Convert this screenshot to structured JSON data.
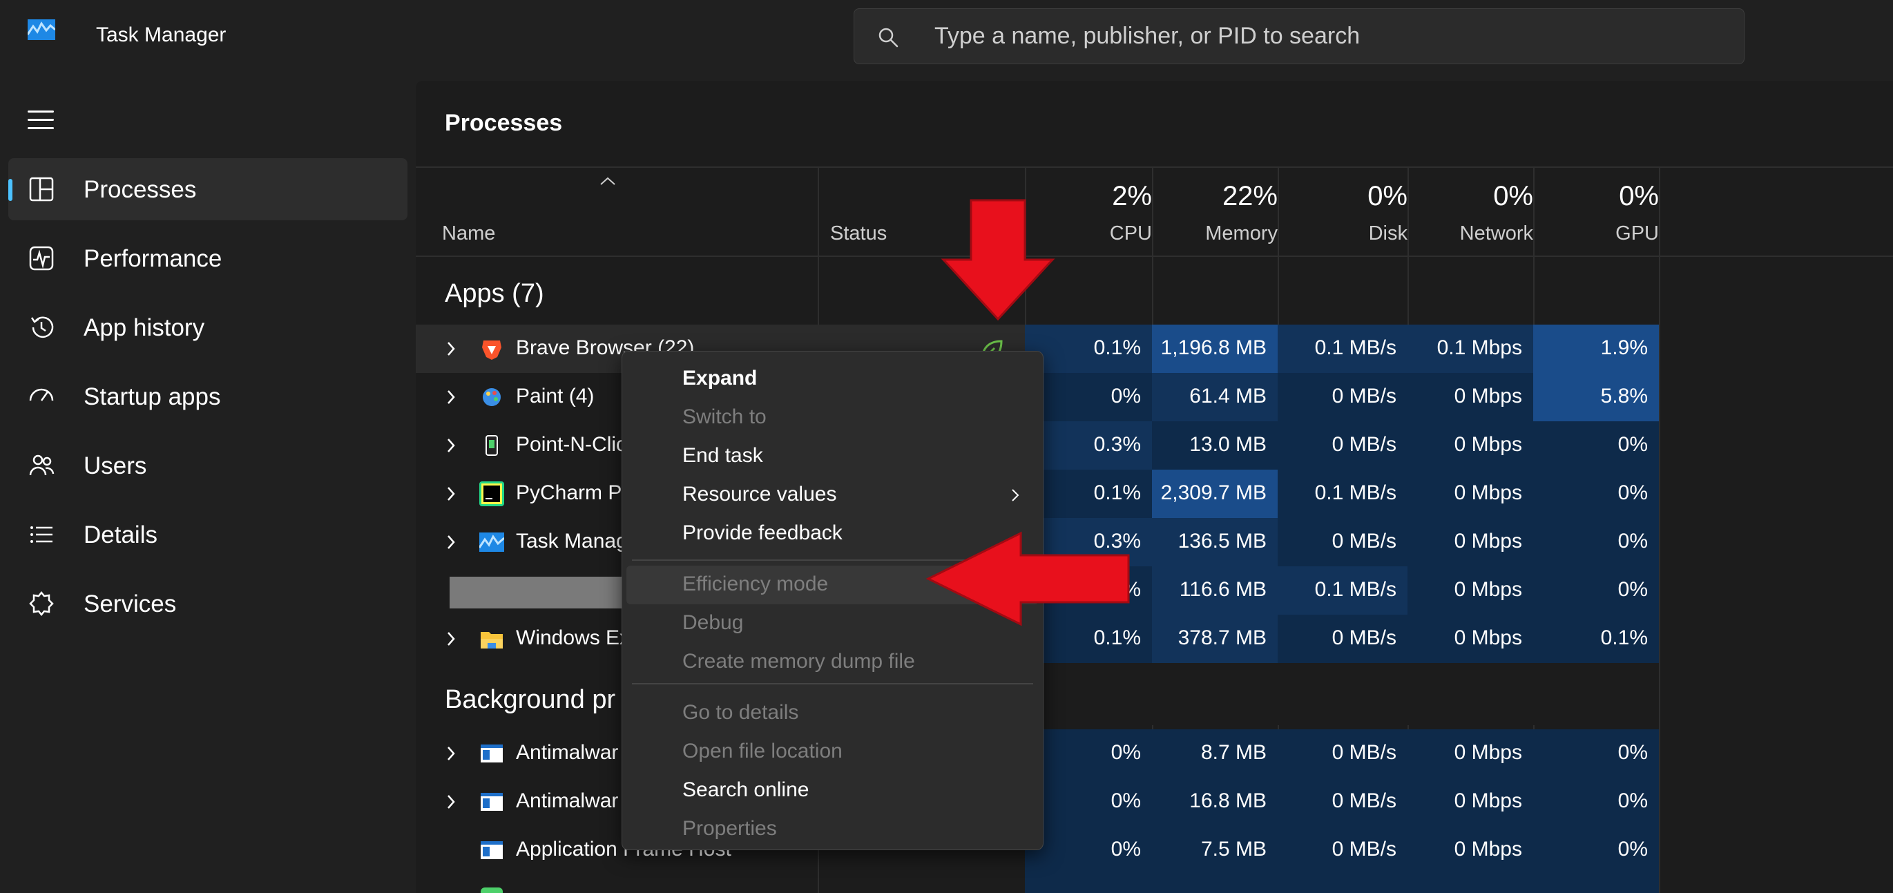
{
  "app": {
    "title": "Task Manager"
  },
  "search": {
    "placeholder": "Type a name, publisher, or PID to search"
  },
  "sidebar": {
    "items": [
      {
        "label": "Processes",
        "icon": "processes-icon"
      },
      {
        "label": "Performance",
        "icon": "performance-icon"
      },
      {
        "label": "App history",
        "icon": "app-history-icon"
      },
      {
        "label": "Startup apps",
        "icon": "startup-apps-icon"
      },
      {
        "label": "Users",
        "icon": "users-icon"
      },
      {
        "label": "Details",
        "icon": "details-icon"
      },
      {
        "label": "Services",
        "icon": "services-icon"
      }
    ]
  },
  "main": {
    "title": "Processes",
    "columns": {
      "name": "Name",
      "status": "Status",
      "cpu": {
        "pct": "2%",
        "label": "CPU"
      },
      "memory": {
        "pct": "22%",
        "label": "Memory"
      },
      "disk": {
        "pct": "0%",
        "label": "Disk"
      },
      "network": {
        "pct": "0%",
        "label": "Network"
      },
      "gpu": {
        "pct": "0%",
        "label": "GPU"
      }
    },
    "apps_header": "Apps (7)",
    "bg_header": "Background pr",
    "apps": [
      {
        "name": "Brave Browser (22)",
        "cpu": "0.1%",
        "memory": "1,196.8 MB",
        "disk": "0.1 MB/s",
        "network": "0.1 Mbps",
        "gpu": "1.9%",
        "icon": "brave-icon"
      },
      {
        "name": "Paint (4)",
        "cpu": "0%",
        "memory": "61.4 MB",
        "disk": "0 MB/s",
        "network": "0 Mbps",
        "gpu": "5.8%",
        "icon": "paint-icon"
      },
      {
        "name": "Point-N-Clic",
        "cpu": "0.3%",
        "memory": "13.0 MB",
        "disk": "0 MB/s",
        "network": "0 Mbps",
        "gpu": "0%",
        "icon": "point-n-click-icon"
      },
      {
        "name": "PyCharm Pr",
        "cpu": "0.1%",
        "memory": "2,309.7 MB",
        "disk": "0.1 MB/s",
        "network": "0 Mbps",
        "gpu": "0%",
        "icon": "pycharm-icon"
      },
      {
        "name": "Task Manag",
        "cpu": "0.3%",
        "memory": "136.5 MB",
        "disk": "0 MB/s",
        "network": "0 Mbps",
        "gpu": "0%",
        "icon": "task-manager-icon"
      },
      {
        "name": "",
        "cpu": "%",
        "memory": "116.6 MB",
        "disk": "0.1 MB/s",
        "network": "0 Mbps",
        "gpu": "0%",
        "icon": ""
      },
      {
        "name": "Windows Ex",
        "cpu": "0.1%",
        "memory": "378.7 MB",
        "disk": "0 MB/s",
        "network": "0 Mbps",
        "gpu": "0.1%",
        "icon": "folder-icon"
      }
    ],
    "background": [
      {
        "name": "Antimalwar",
        "cpu": "0%",
        "memory": "8.7 MB",
        "disk": "0 MB/s",
        "network": "0 Mbps",
        "gpu": "0%",
        "icon": "service-window-icon"
      },
      {
        "name": "Antimalwar",
        "cpu": "0%",
        "memory": "16.8 MB",
        "disk": "0 MB/s",
        "network": "0 Mbps",
        "gpu": "0%",
        "icon": "service-window-icon"
      },
      {
        "name": "Application Frame Host",
        "cpu": "0%",
        "memory": "7.5 MB",
        "disk": "0 MB/s",
        "network": "0 Mbps",
        "gpu": "0%",
        "icon": "service-window-icon"
      }
    ]
  },
  "context_menu": {
    "items": [
      {
        "label": "Expand",
        "enabled": true
      },
      {
        "label": "Switch to",
        "enabled": false
      },
      {
        "label": "End task",
        "enabled": true
      },
      {
        "label": "Resource values",
        "enabled": true,
        "submenu": true
      },
      {
        "label": "Provide feedback",
        "enabled": true
      },
      {
        "label": "Efficiency mode",
        "enabled": false
      },
      {
        "label": "Debug",
        "enabled": false
      },
      {
        "label": "Create memory dump file",
        "enabled": false
      },
      {
        "label": "Go to details",
        "enabled": false
      },
      {
        "label": "Open file location",
        "enabled": false
      },
      {
        "label": "Search online",
        "enabled": true
      },
      {
        "label": "Properties",
        "enabled": false
      }
    ]
  },
  "colors": {
    "accent": "#4cc2ff",
    "annotation_arrow": "#e8101c",
    "efficiency_leaf": "#6cc24a"
  }
}
